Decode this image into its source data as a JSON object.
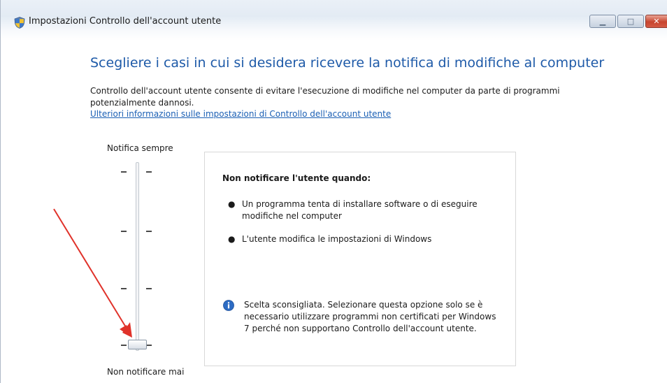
{
  "window": {
    "title": "Impostazioni Controllo dell'account utente",
    "caption_buttons": {
      "minimize": "▁",
      "maximize": "□",
      "close": "✕"
    }
  },
  "main": {
    "heading": "Scegliere i casi in cui si desidera ricevere la notifica di modifiche al computer",
    "description": "Controllo dell'account utente consente di evitare l'esecuzione di modifiche nel computer da parte di programmi potenzialmente dannosi.",
    "help_link": "Ulteriori informazioni sulle impostazioni di Controllo dell'account utente"
  },
  "slider": {
    "top_label": "Notifica sempre",
    "bottom_label": "Non notificare mai",
    "level_count": 4,
    "selected_level": 0
  },
  "info_box": {
    "title": "Non notificare l'utente quando:",
    "bullets": [
      "Un programma tenta di installare software o di eseguire modifiche nel computer",
      "L'utente modifica le impostazioni di Windows"
    ],
    "note": "Scelta sconsigliata. Selezionare questa opzione solo se è necessario utilizzare programmi non certificati per Windows 7 perché non supportano Controllo dell'account utente."
  },
  "colors": {
    "heading": "#1e5aa8",
    "link": "#1a5fb4",
    "arrow": "#e0322a"
  },
  "icons": {
    "title_icon": "uac-shield-icon",
    "note_icon": "info-icon"
  }
}
